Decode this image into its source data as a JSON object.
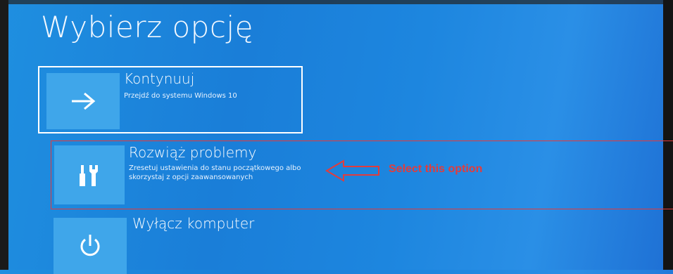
{
  "screen": {
    "title": "Wybierz opcję"
  },
  "options": [
    {
      "title": "Kontynuuj",
      "description": "Przejdź do systemu Windows 10",
      "icon": "arrow-right-icon"
    },
    {
      "title": "Rozwiąż problemy",
      "description": "Zresetuj ustawienia do stanu początkowego albo skorzystaj z opcji zaawansowanych",
      "icon": "tools-icon"
    },
    {
      "title": "Wyłącz komputer",
      "description": "",
      "icon": "power-icon"
    }
  ],
  "annotation": {
    "text": "Select this option",
    "color": "#e23c3c"
  },
  "colors": {
    "background": "#1a7ed8",
    "tile": "#3fa6ea",
    "focus_border": "#ffffff"
  }
}
